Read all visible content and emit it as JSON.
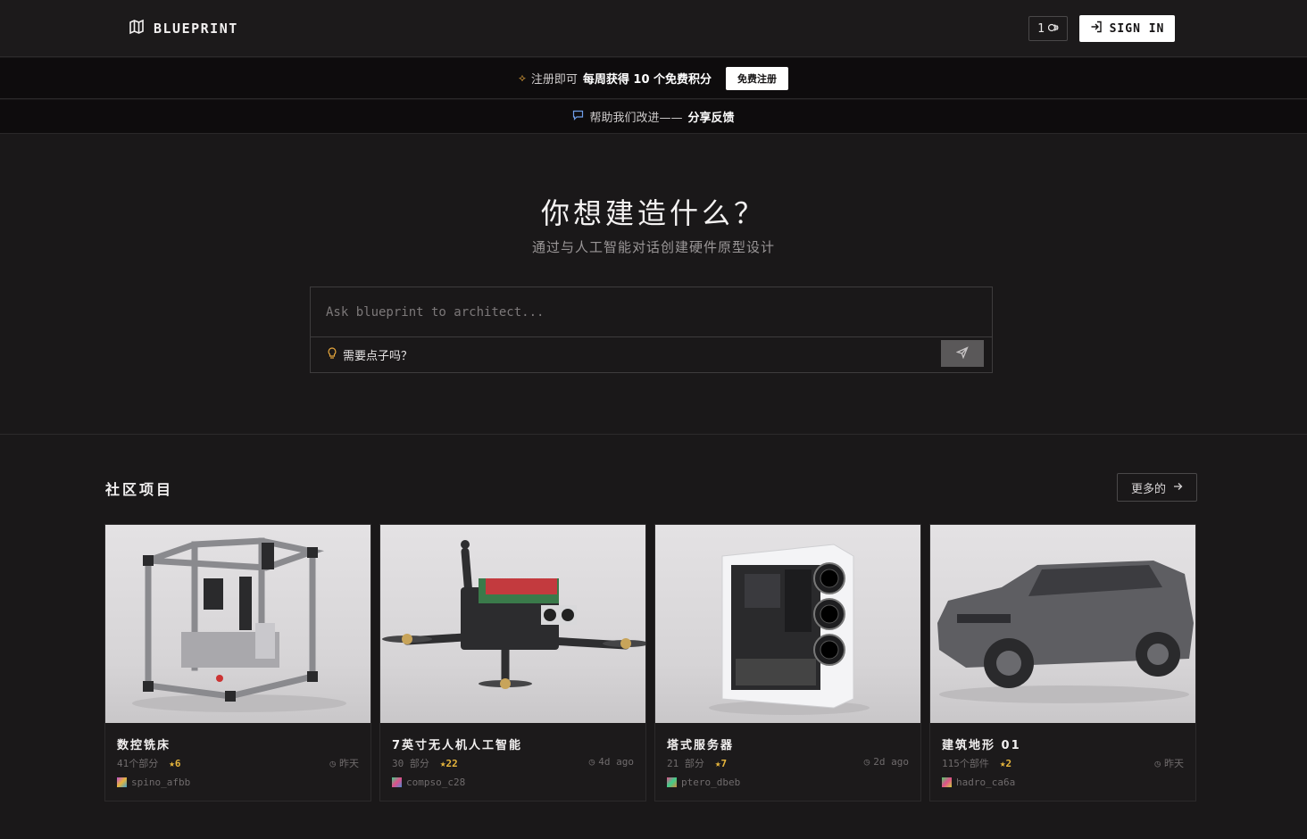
{
  "header": {
    "brand": "BLUEPRINT",
    "credits": "1",
    "sign_in": "SIGN IN"
  },
  "promo": {
    "text_prefix": "注册即可",
    "text_bold": "每周获得 10 个免费积分",
    "cta": "免费注册"
  },
  "feedback": {
    "text": "帮助我们改进——",
    "link": "分享反馈"
  },
  "hero": {
    "title": "你想建造什么？",
    "subtitle": "通过与人工智能对话创建硬件原型设计",
    "placeholder": "Ask blueprint to architect...",
    "ideas": "需要点子吗？"
  },
  "community": {
    "title": "社区项目",
    "more": "更多的",
    "cards": [
      {
        "title": "数控铣床",
        "parts": "41个部分",
        "stars": "6",
        "time": "昨天",
        "author": "spino_afbb",
        "avatar_color": "#c04fcf"
      },
      {
        "title": "7英寸无人机人工智能",
        "parts": "30 部分",
        "stars": "22",
        "time": "4d ago",
        "author": "compso_c28",
        "avatar_color": "#3fcf8a"
      },
      {
        "title": "塔式服务器",
        "parts": "21 部分",
        "stars": "7",
        "time": "2d ago",
        "author": "ptero_dbeb",
        "avatar_color": "#e04f8a"
      },
      {
        "title": "建筑地形 01",
        "parts": "115个部件",
        "stars": "2",
        "time": "昨天",
        "author": "hadro_ca6a",
        "avatar_color": "#4fcf6a"
      }
    ]
  },
  "colors": {
    "background": "#1a1819",
    "accent_star": "#e6b53c",
    "promo_icon": "#e6a63c"
  }
}
